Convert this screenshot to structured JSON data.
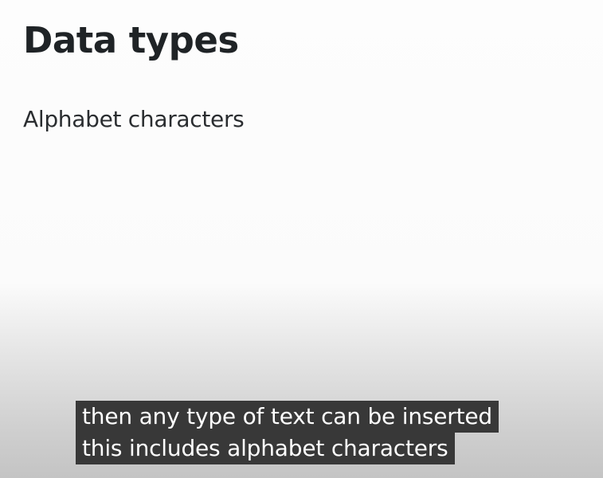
{
  "slide": {
    "title": "Data types",
    "subtitle": "Alphabet characters"
  },
  "captions": {
    "lines": [
      "then any type of text can be inserted",
      "this includes alphabet characters"
    ]
  }
}
